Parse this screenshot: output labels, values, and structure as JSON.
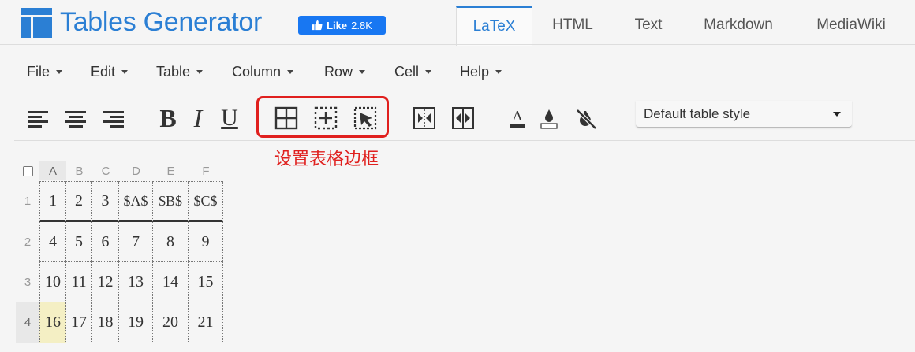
{
  "app": {
    "title": "Tables Generator",
    "like_label": "Like",
    "like_count": "2.8K",
    "brand_color": "#2b7fd4"
  },
  "tabs": [
    {
      "label": "LaTeX",
      "active": true
    },
    {
      "label": "HTML",
      "active": false
    },
    {
      "label": "Text",
      "active": false
    },
    {
      "label": "Markdown",
      "active": false
    },
    {
      "label": "MediaWiki",
      "active": false
    }
  ],
  "menu": [
    "File",
    "Edit",
    "Table",
    "Column",
    "Row",
    "Cell",
    "Help"
  ],
  "toolbar": {
    "bold": "B",
    "italic": "I",
    "underline": "U",
    "text_color_letter": "A",
    "table_style": "Default table style"
  },
  "annotation": {
    "text": "设置表格边框",
    "color": "#e0201e"
  },
  "grid": {
    "columns": [
      "A",
      "B",
      "C",
      "D",
      "E",
      "F"
    ],
    "rows": [
      "1",
      "2",
      "3",
      "4"
    ],
    "cells": [
      [
        "1",
        "2",
        "3",
        "$A$",
        "$B$",
        "$C$"
      ],
      [
        "4",
        "5",
        "6",
        "7",
        "8",
        "9"
      ],
      [
        "10",
        "11",
        "12",
        "13",
        "14",
        "15"
      ],
      [
        "16",
        "17",
        "18",
        "19",
        "20",
        "21"
      ]
    ],
    "selected_column": "A",
    "selected_row": "4",
    "selected_cell_color": "#f4efc4"
  }
}
